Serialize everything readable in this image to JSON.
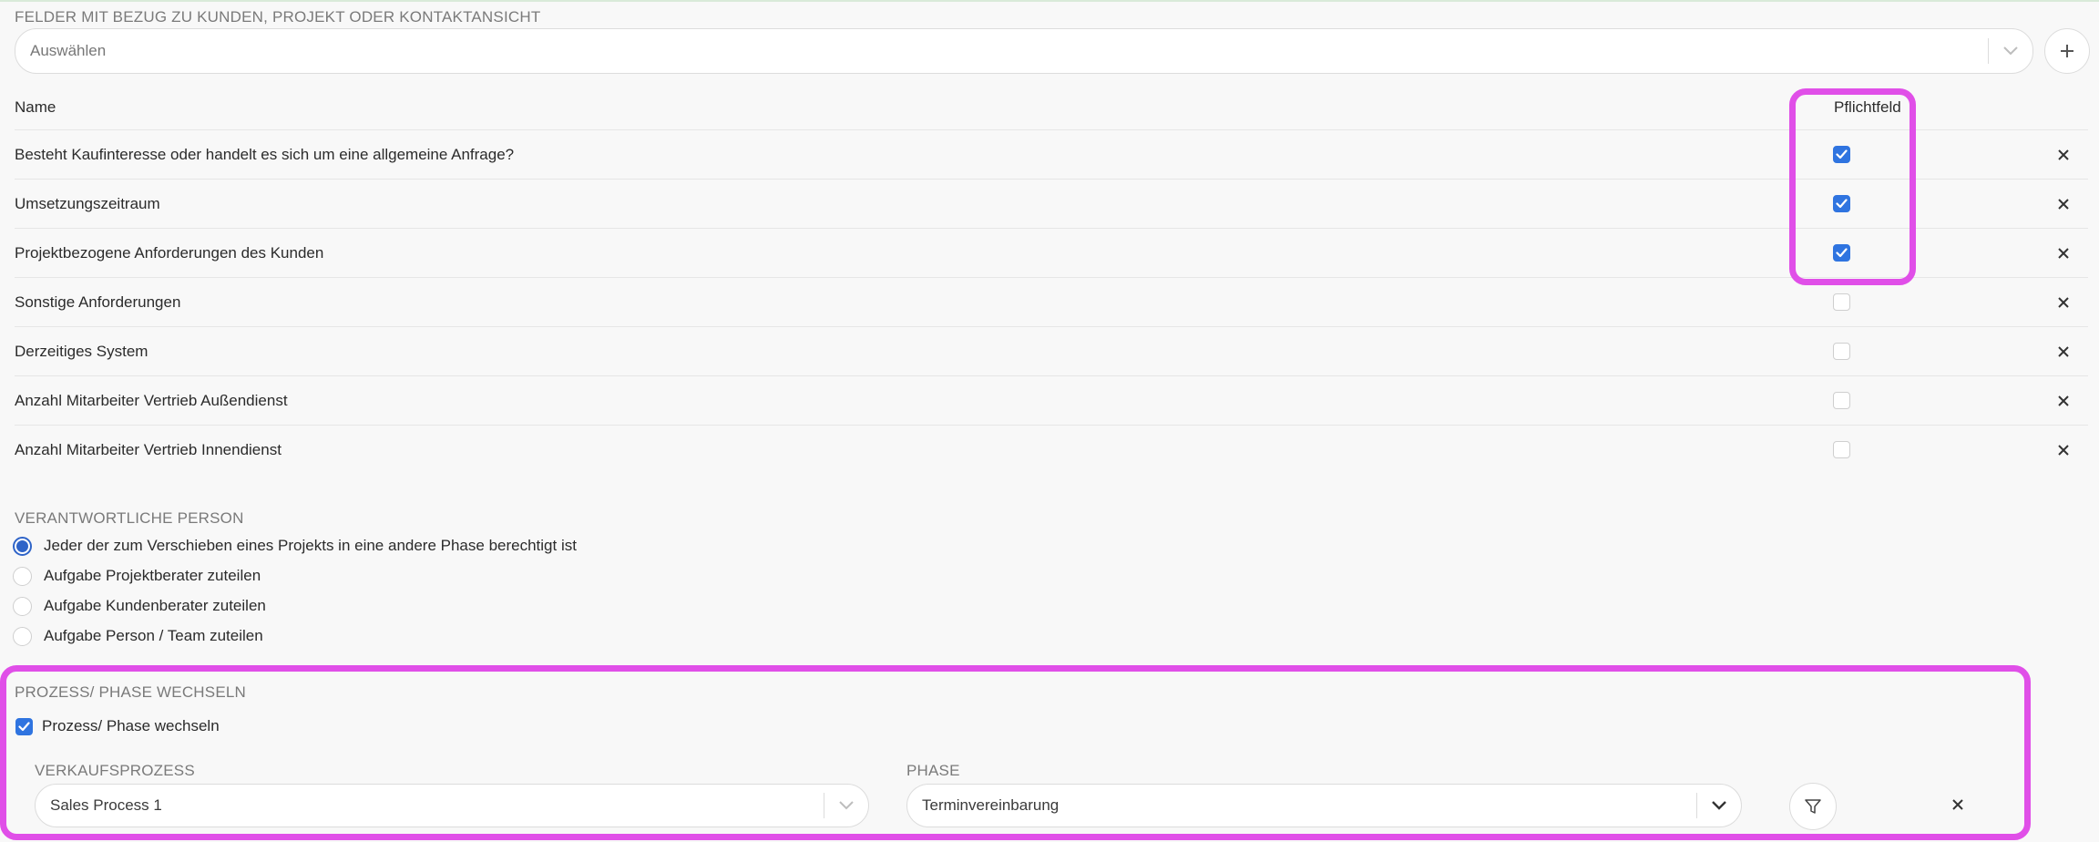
{
  "fields_section": {
    "label": "FELDER MIT BEZUG ZU KUNDEN, PROJEKT ODER KONTAKTANSICHT",
    "select_placeholder": "Auswählen"
  },
  "table": {
    "col_name": "Name",
    "col_required": "Pflichtfeld",
    "rows": [
      {
        "name": "Besteht Kaufinteresse oder handelt es sich um eine allgemeine Anfrage?",
        "required": true
      },
      {
        "name": "Umsetzungszeitraum",
        "required": true
      },
      {
        "name": "Projektbezogene Anforderungen des Kunden",
        "required": true
      },
      {
        "name": "Sonstige Anforderungen",
        "required": false
      },
      {
        "name": "Derzeitiges System",
        "required": false
      },
      {
        "name": "Anzahl Mitarbeiter Vertrieb Außendienst",
        "required": false
      },
      {
        "name": "Anzahl Mitarbeiter Vertrieb Innendienst",
        "required": false
      }
    ]
  },
  "responsible": {
    "label": "VERANTWORTLICHE PERSON",
    "options": [
      {
        "label": "Jeder der zum Verschieben eines Projekts in eine andere Phase berechtigt ist",
        "selected": true
      },
      {
        "label": "Aufgabe Projektberater zuteilen",
        "selected": false
      },
      {
        "label": "Aufgabe Kundenberater zuteilen",
        "selected": false
      },
      {
        "label": "Aufgabe Person / Team zuteilen",
        "selected": false
      }
    ]
  },
  "process": {
    "label": "PROZESS/ PHASE WECHSELN",
    "checkbox_label": "Prozess/ Phase wechseln",
    "checkbox_checked": true,
    "sales_process_label": "VERKAUFSPROZESS",
    "sales_process_value": "Sales Process 1",
    "phase_label": "PHASE",
    "phase_value": "Terminvereinbarung"
  },
  "colors": {
    "highlight": "#e04fe8",
    "checkbox_blue": "#2f74e0",
    "radio_blue": "#2f64c8"
  }
}
